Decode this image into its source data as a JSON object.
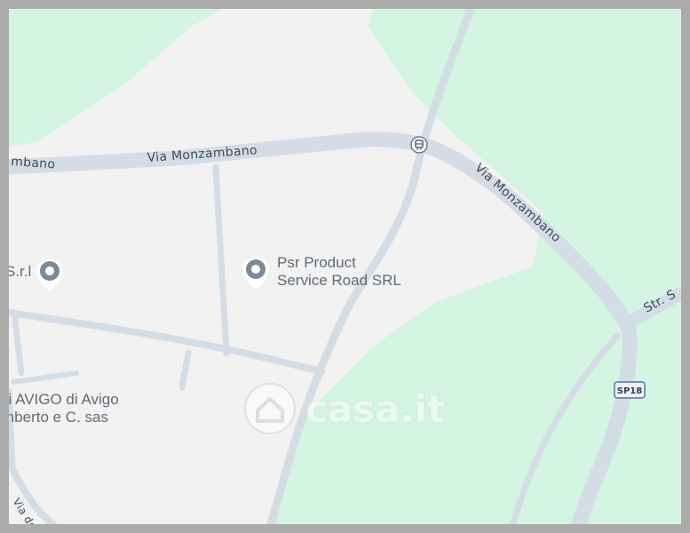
{
  "map": {
    "colors": {
      "land": "#f2f2f2",
      "park": "#d3f5e1",
      "road_fill": "#d4dde6",
      "road_label": "#3e4a57",
      "poi_pin": "#7b8a98",
      "frame": "#ababab"
    },
    "roads": [
      {
        "id": "via-monzambano-west",
        "label": "mbano"
      },
      {
        "id": "via-monzambano-center",
        "label": "Via Monzambano"
      },
      {
        "id": "via-monzambano-east",
        "label": "Via Monzambano"
      },
      {
        "id": "str-s",
        "label": "Str. S"
      },
      {
        "id": "via-delle",
        "label": "Via dell"
      }
    ],
    "route_shield": {
      "label": "SP18"
    },
    "pois": [
      {
        "id": "srl-left",
        "label": "S.r.l",
        "icon": "location-pin-icon"
      },
      {
        "id": "psr",
        "label": "Psr Product\nService Road SRL",
        "icon": "location-pin-icon"
      },
      {
        "id": "avigo",
        "label": "lli AVIGO di Avigo\nmberto e C. sas"
      }
    ],
    "transit_stop": {
      "icon": "bus-stop-icon"
    },
    "watermark": {
      "text": "casa.it",
      "icon": "house-logo-icon"
    }
  }
}
